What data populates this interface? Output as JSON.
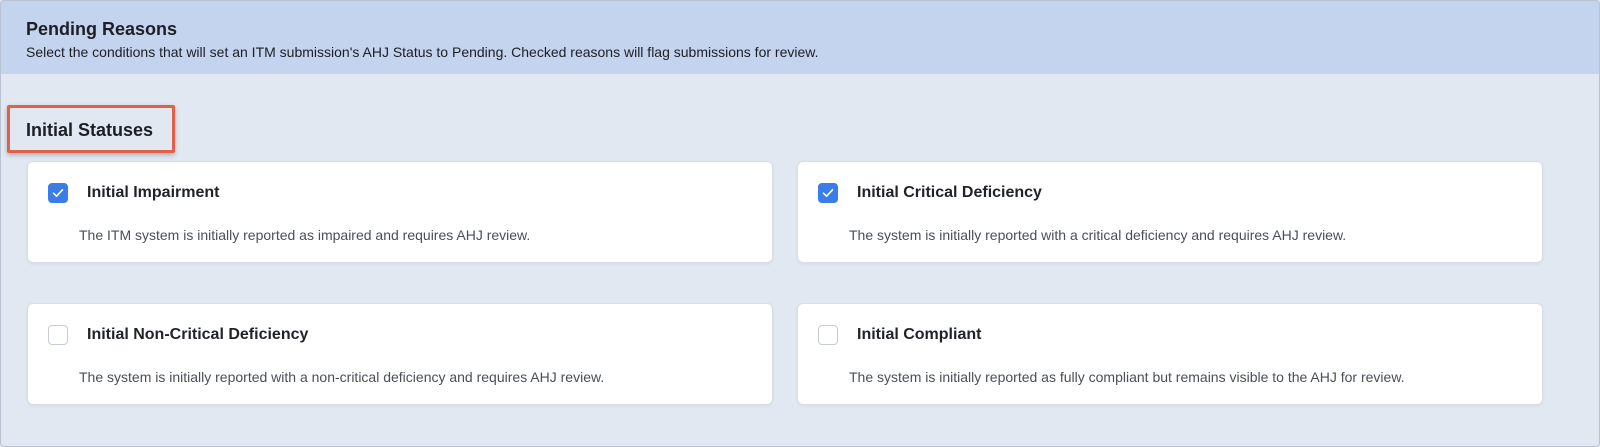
{
  "header": {
    "title": "Pending Reasons",
    "description": "Select the conditions that will set an ITM submission's AHJ Status to Pending. Checked reasons will flag submissions for review."
  },
  "section": {
    "heading": "Initial Statuses"
  },
  "reasons": [
    {
      "title": "Initial Impairment",
      "description": "The ITM system is initially reported as impaired and requires AHJ review.",
      "checked": true
    },
    {
      "title": "Initial Critical Deficiency",
      "description": "The system is initially reported with a critical deficiency and requires AHJ review.",
      "checked": true
    },
    {
      "title": "Initial Non-Critical Deficiency",
      "description": "The system is initially reported with a non-critical deficiency and requires AHJ review.",
      "checked": false
    },
    {
      "title": "Initial Compliant",
      "description": "The system is initially reported as fully compliant but remains visible to the AHJ for review.",
      "checked": false
    }
  ],
  "colors": {
    "header_bg": "#c4d4ee",
    "panel_bg": "#e2e8f1",
    "checkbox_checked": "#3b7de8",
    "highlight_border": "#e0604a"
  },
  "icons": {
    "checkmark": "check-icon"
  }
}
